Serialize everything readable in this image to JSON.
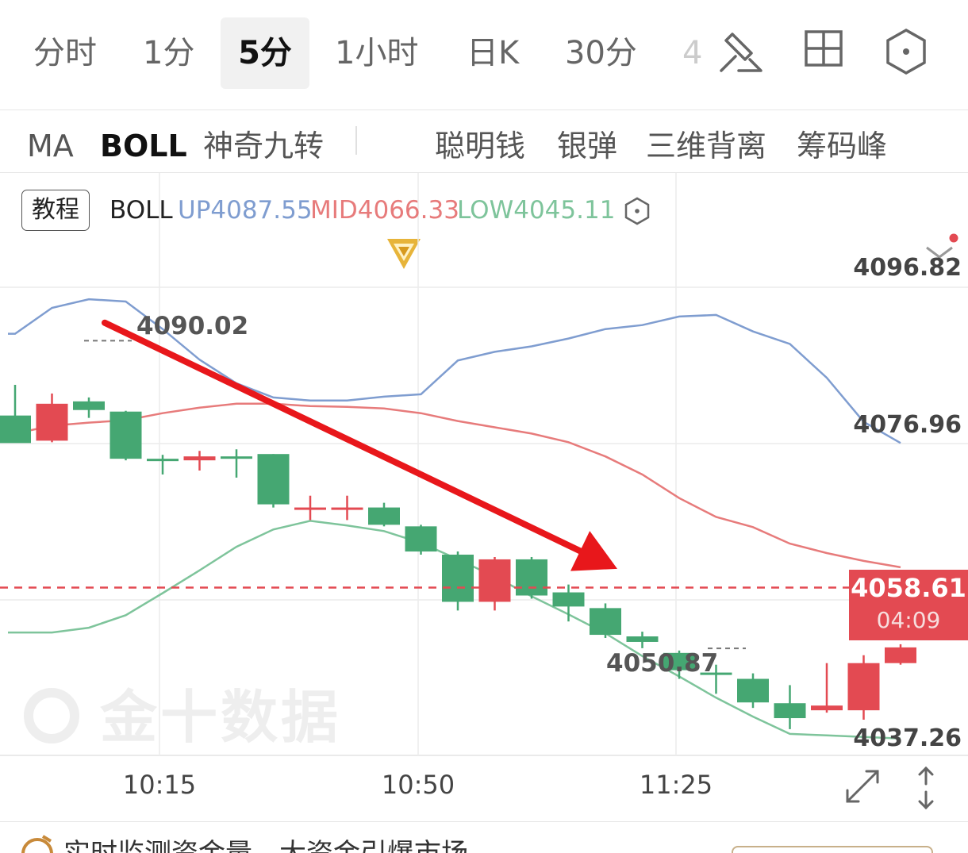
{
  "timeframes": {
    "items": [
      "分时",
      "1分",
      "5分",
      "1小时",
      "日K",
      "30分"
    ],
    "active": "5分",
    "overflow_hint": "4"
  },
  "indicators": {
    "items": [
      "MA",
      "BOLL",
      "神奇九转",
      "聪明钱",
      "银弹",
      "三维背离",
      "筹码峰"
    ],
    "active": "BOLL"
  },
  "legend": {
    "tutorial": "教程",
    "name": "BOLL",
    "up": "UP4087.55",
    "mid": "MID4066.33",
    "low": "LOW4045.11",
    "colors": {
      "up": "#7f9dd0",
      "mid": "#e77b7b",
      "low": "#7ec49b"
    }
  },
  "price_axis": [
    "4096.82",
    "4076.96",
    "4037.26"
  ],
  "current": {
    "price": "4058.61",
    "countdown": "04:09",
    "color": "#e34a52"
  },
  "annotations": {
    "high": "4090.02",
    "low": "4050.87"
  },
  "time_axis": [
    "10:15",
    "10:50",
    "11:25"
  ],
  "watermark": "金十数据",
  "banner": "实时监测资金量，大资金引爆市场",
  "chart_data": {
    "type": "candlestick",
    "interval": "5分",
    "ylim": [
      4037.26,
      4096.82
    ],
    "colors": {
      "up": "#e34a52",
      "down": "#45a772"
    },
    "candles": [
      {
        "o": 4080.5,
        "h": 4084.4,
        "l": 4077.6,
        "c": 4077.0
      },
      {
        "o": 4077.3,
        "h": 4083.3,
        "l": 4077.1,
        "c": 4082.0
      },
      {
        "o": 4082.3,
        "h": 4082.8,
        "l": 4080.2,
        "c": 4081.2
      },
      {
        "o": 4081.0,
        "h": 4081.1,
        "l": 4074.8,
        "c": 4075.0
      },
      {
        "o": 4075.0,
        "h": 4075.5,
        "l": 4073.0,
        "c": 4074.8
      },
      {
        "o": 4074.8,
        "h": 4076.0,
        "l": 4073.5,
        "c": 4075.3
      },
      {
        "o": 4075.3,
        "h": 4076.2,
        "l": 4072.6,
        "c": 4075.0
      },
      {
        "o": 4075.6,
        "h": 4075.6,
        "l": 4068.8,
        "c": 4069.2
      },
      {
        "o": 4068.8,
        "h": 4070.3,
        "l": 4067.2,
        "c": 4068.8
      },
      {
        "o": 4068.8,
        "h": 4070.3,
        "l": 4067.2,
        "c": 4068.8
      },
      {
        "o": 4068.8,
        "h": 4069.4,
        "l": 4066.4,
        "c": 4066.6
      },
      {
        "o": 4066.4,
        "h": 4066.6,
        "l": 4062.8,
        "c": 4063.2
      },
      {
        "o": 4062.8,
        "h": 4063.2,
        "l": 4055.7,
        "c": 4056.8
      },
      {
        "o": 4056.8,
        "h": 4062.5,
        "l": 4055.7,
        "c": 4062.2
      },
      {
        "o": 4062.2,
        "h": 4062.5,
        "l": 4057.2,
        "c": 4057.6
      },
      {
        "o": 4058.0,
        "h": 4059.0,
        "l": 4054.3,
        "c": 4056.2
      },
      {
        "o": 4056.0,
        "h": 4056.6,
        "l": 4052.2,
        "c": 4052.6
      },
      {
        "o": 4052.4,
        "h": 4053.0,
        "l": 4050.9,
        "c": 4051.7
      },
      {
        "o": 4050.3,
        "h": 4050.6,
        "l": 4047.0,
        "c": 4048.1
      },
      {
        "o": 4047.8,
        "h": 4048.8,
        "l": 4045.1,
        "c": 4047.6
      },
      {
        "o": 4047.0,
        "h": 4047.7,
        "l": 4043.3,
        "c": 4044.0
      },
      {
        "o": 4043.9,
        "h": 4046.2,
        "l": 4040.6,
        "c": 4042.0
      },
      {
        "o": 4043.0,
        "h": 4049.0,
        "l": 4042.7,
        "c": 4043.6
      },
      {
        "o": 4043.0,
        "h": 4050.0,
        "l": 4041.8,
        "c": 4049.0
      },
      {
        "o": 4049.0,
        "h": 4051.4,
        "l": 4048.8,
        "c": 4051.0
      }
    ],
    "boll_up": [
      4090.9,
      4094.2,
      4095.3,
      4095.0,
      4091.5,
      4087.6,
      4084.6,
      4082.8,
      4082.4,
      4082.4,
      4082.9,
      4083.2,
      4087.5,
      4088.6,
      4089.3,
      4090.3,
      4091.5,
      4092.0,
      4093.1,
      4093.3,
      4091.2,
      4089.6,
      4085.3,
      4079.7,
      4077.0
    ],
    "boll_mid": [
      4078.2,
      4079.2,
      4079.6,
      4079.9,
      4080.8,
      4081.5,
      4082.0,
      4082.0,
      4081.7,
      4081.6,
      4081.4,
      4080.8,
      4079.8,
      4079.0,
      4078.2,
      4077.1,
      4075.3,
      4073.0,
      4070.0,
      4067.6,
      4066.3,
      4064.2,
      4063.0,
      4062.0,
      4061.2
    ],
    "boll_low": [
      4052.9,
      4052.9,
      4053.5,
      4055.1,
      4057.9,
      4060.8,
      4063.8,
      4066.0,
      4067.1,
      4066.5,
      4065.8,
      4064.3,
      4062.2,
      4060.0,
      4057.5,
      4055.2,
      4052.8,
      4049.9,
      4047.3,
      4044.6,
      4042.2,
      4040.0,
      4039.8,
      4039.6,
      4039.4
    ],
    "arrow": {
      "from": 4092.3,
      "to": 4061.0
    }
  }
}
